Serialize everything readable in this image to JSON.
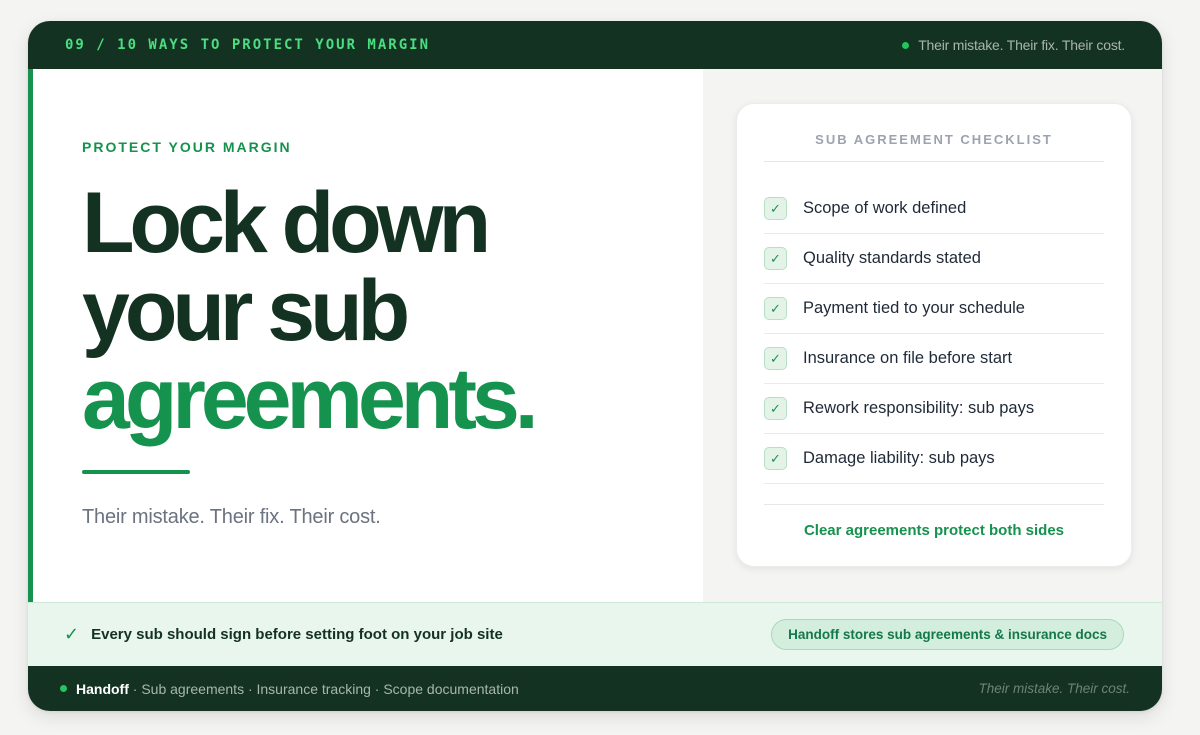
{
  "header": {
    "title": "09 / 10 WAYS TO PROTECT YOUR MARGIN",
    "tagline": "Their mistake. Their fix. Their cost."
  },
  "hero": {
    "eyebrow": "PROTECT YOUR MARGIN",
    "headline_line1": "Lock down",
    "headline_line2": "your sub",
    "headline_line3": "agreements.",
    "subline": "Their mistake. Their fix. Their cost."
  },
  "checklist": {
    "title": "SUB AGREEMENT CHECKLIST",
    "items": [
      {
        "label": "Scope of work defined",
        "checked": true
      },
      {
        "label": "Quality standards stated",
        "checked": true
      },
      {
        "label": "Payment tied to your schedule",
        "checked": true
      },
      {
        "label": "Insurance on file before start",
        "checked": true
      },
      {
        "label": "Rework responsibility: sub pays",
        "checked": true
      },
      {
        "label": "Damage liability: sub pays",
        "checked": true
      }
    ],
    "check_glyph": "✓",
    "footer": "Clear agreements protect both sides"
  },
  "banner": {
    "check_glyph": "✓",
    "text": "Every sub should sign before setting foot on your job site",
    "pill": "Handoff stores sub agreements & insurance docs"
  },
  "footer": {
    "brand": "Handoff",
    "items": " · Sub agreements · Insurance tracking · Scope documentation",
    "tagline": "Their mistake. Their cost."
  },
  "colors": {
    "dark_green": "#143221",
    "accent_green": "#15924d",
    "bright_green": "#4ade80"
  }
}
